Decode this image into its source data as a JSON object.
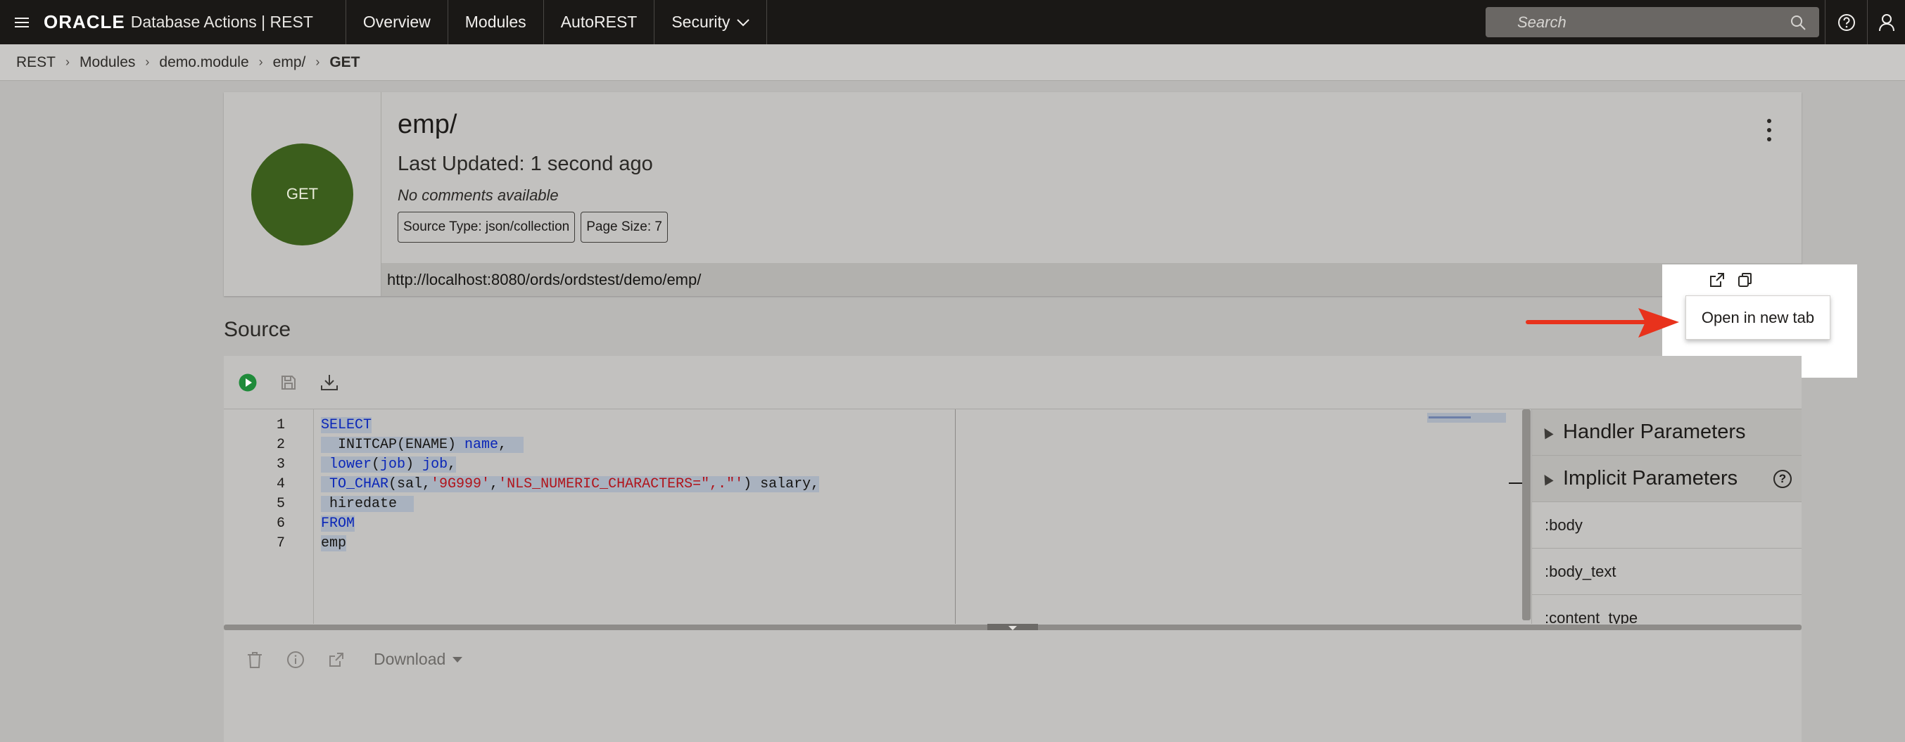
{
  "header": {
    "brand_logo": "ORACLE",
    "brand_text": "Database Actions | REST",
    "nav": [
      {
        "label": "Overview"
      },
      {
        "label": "Modules"
      },
      {
        "label": "AutoREST"
      },
      {
        "label": "Security"
      }
    ],
    "search_placeholder": "Search"
  },
  "breadcrumb": [
    "REST",
    "Modules",
    "demo.module",
    "emp/",
    "GET"
  ],
  "handler": {
    "method": "GET",
    "title": "emp/",
    "last_updated": "Last Updated: 1 second ago",
    "comment": "No comments available",
    "source_type": "Source Type: json/collection",
    "page_size": "Page Size: 7",
    "url": "http://localhost:8080/ords/ordstest/demo/emp/"
  },
  "tooltip": "Open in new tab",
  "source": {
    "heading": "Source",
    "line_numbers": [
      "1",
      "2",
      "3",
      "4",
      "5",
      "6",
      "7"
    ],
    "code": {
      "l1": "SELECT",
      "l2a": "  INITCAP(ENAME) ",
      "l2b": "name",
      "l2c": ",",
      "l3a": "lower",
      "l3b": "(",
      "l3c": "job",
      "l3d": ") ",
      "l3e": "job",
      "l3f": ",",
      "l4a": "TO_CHAR",
      "l4b": "(sal,",
      "l4c": "'9G999'",
      "l4d": ",",
      "l4e": "'NLS_NUMERIC_CHARACTERS=\",.\"'",
      "l4f": ") salary,",
      "l5": "hiredate",
      "l6": "FROM",
      "l7": "emp"
    },
    "side": {
      "handler_params": "Handler Parameters",
      "implicit_params": "Implicit Parameters",
      "help": "?",
      "params": [
        ":body",
        ":body_text",
        ":content_type"
      ]
    }
  },
  "output": {
    "download_label": "Download"
  },
  "colors": {
    "topbar": "#1a1816",
    "method_green": "#3b5e1c",
    "arrow_red": "#e8321c",
    "run_green": "#1f8b3a"
  }
}
